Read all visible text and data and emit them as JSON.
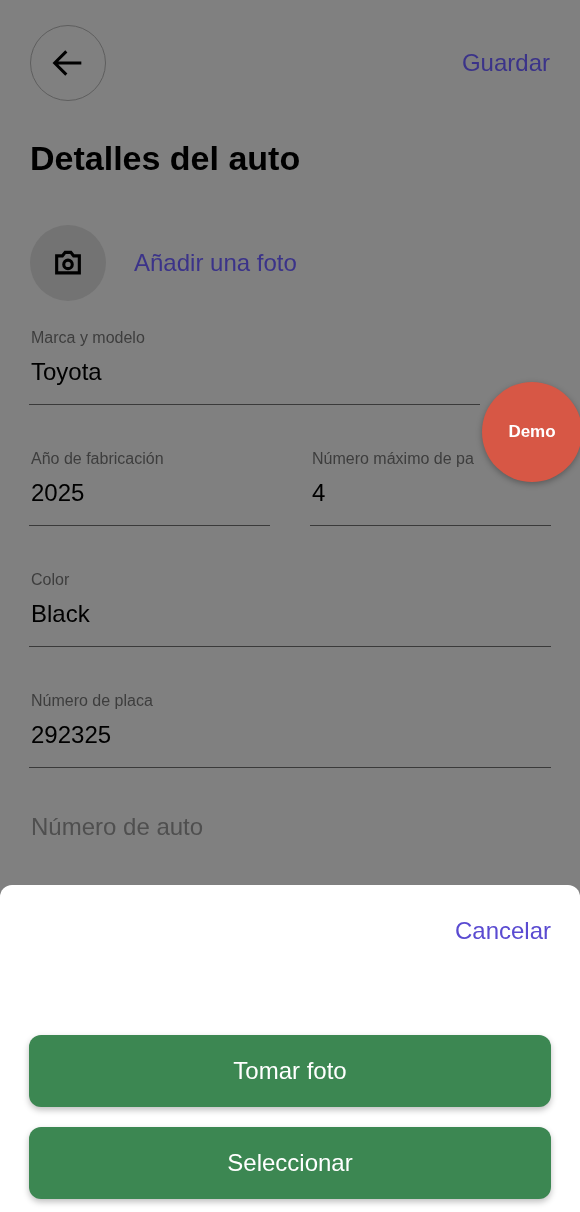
{
  "header": {
    "action": "Guardar"
  },
  "title": "Detalles del auto",
  "photo": {
    "label": "Añadir una foto"
  },
  "field_rows": [
    [
      {
        "label": "Marca y modelo",
        "value": "Toyota"
      }
    ],
    [
      {
        "label": "Año de fabricación",
        "value": "2025"
      },
      {
        "label": "Número máximo de pa",
        "value": "4"
      }
    ],
    [
      {
        "label": "Color",
        "value": "Black"
      }
    ],
    [
      {
        "label": "Número de placa",
        "value": "292325"
      }
    ],
    [
      {
        "placeholder": "Número de auto"
      }
    ]
  ],
  "badge": "Demo",
  "sheet": {
    "cancel": "Cancelar",
    "buttons": [
      "Tomar foto",
      "Seleccionar"
    ]
  }
}
